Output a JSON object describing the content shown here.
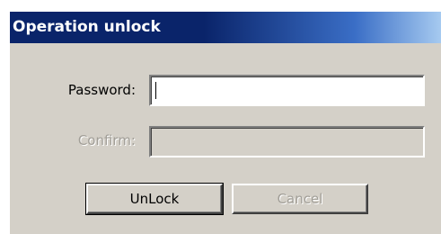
{
  "window": {
    "title": "Operation unlock"
  },
  "form": {
    "password_label": "Password:",
    "password_value": "",
    "confirm_label": "Confirm:",
    "confirm_value": "",
    "confirm_enabled": false
  },
  "buttons": {
    "unlock_label": "UnLock",
    "cancel_label": "Cancel",
    "cancel_enabled": false
  },
  "colors": {
    "titlebar_start": "#0a246a",
    "titlebar_end": "#a6caf0",
    "dialog_background": "#d4d0c8",
    "disabled_text": "#a19e97"
  }
}
